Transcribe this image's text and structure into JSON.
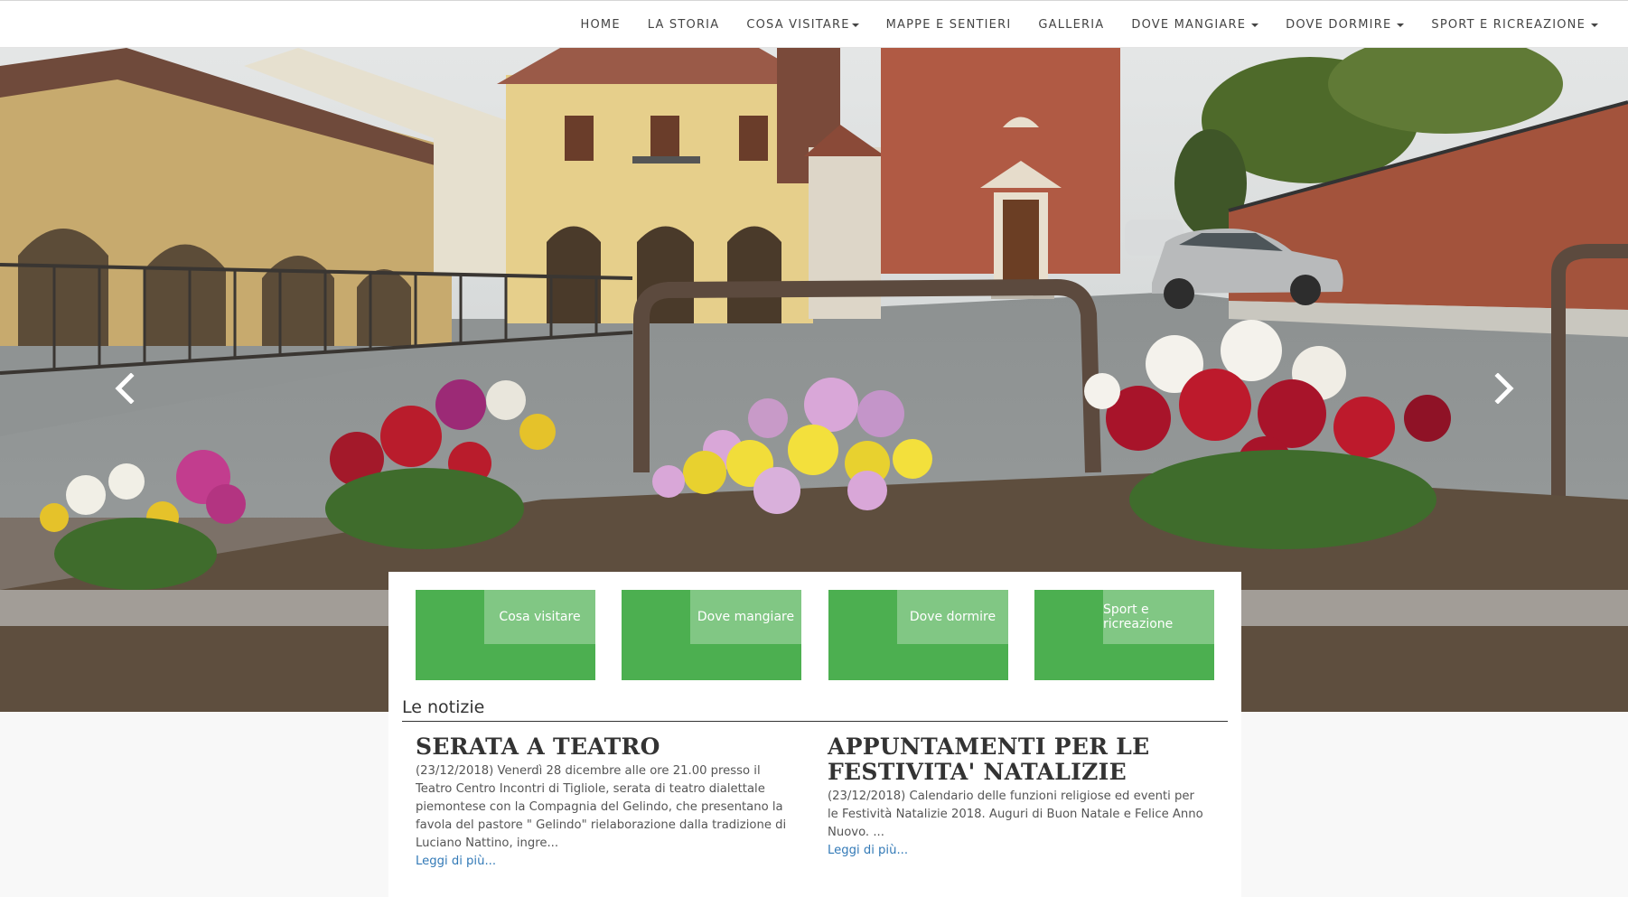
{
  "nav": {
    "items": [
      {
        "label": "HOME",
        "dropdown": false
      },
      {
        "label": "LA STORIA",
        "dropdown": false
      },
      {
        "label": "COSA VISITARE",
        "dropdown": true
      },
      {
        "label": "MAPPE E SENTIERI",
        "dropdown": false
      },
      {
        "label": "GALLERIA",
        "dropdown": false
      },
      {
        "label": "DOVE MANGIARE",
        "dropdown": true
      },
      {
        "label": "DOVE DORMIRE",
        "dropdown": true
      },
      {
        "label": "SPORT E RICREAZIONE",
        "dropdown": true
      }
    ]
  },
  "hero": {
    "prev_icon": "chevron-left-icon",
    "next_icon": "chevron-right-icon"
  },
  "tiles": [
    {
      "label": "Cosa visitare"
    },
    {
      "label": "Dove mangiare"
    },
    {
      "label": "Dove dormire"
    },
    {
      "label": "Sport e ricreazione"
    }
  ],
  "news": {
    "section_title": "Le notizie",
    "more_label": "Leggi di più...",
    "articles": [
      {
        "title": "SERATA A TEATRO",
        "body": "(23/12/2018) Venerdì 28 dicembre alle ore 21.00 presso il Teatro Centro Incontri di Tigliole, serata di teatro dialettale piemontese con la Compagnia del Gelindo, che presentano la favola del pastore \" Gelindo\" rielaborazione dalla tradizione di Luciano Nattino, ingre..."
      },
      {
        "title": "APPUNTAMENTI PER LE FESTIVITA' NATALIZIE",
        "body": "(23/12/2018) Calendario delle funzioni religiose ed eventi per le Festività Natalizie 2018. Auguri di Buon Natale e Felice Anno Nuovo. ..."
      }
    ]
  },
  "colors": {
    "tile_green": "#4caf50",
    "tile_tab_green": "#81c784",
    "link_blue": "#337ab7"
  }
}
